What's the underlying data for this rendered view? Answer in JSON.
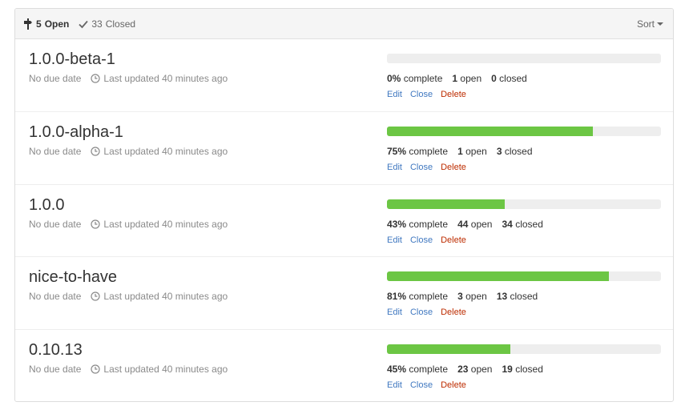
{
  "header": {
    "open_count": "5",
    "open_label": "Open",
    "closed_count": "33",
    "closed_label": "Closed",
    "sort_label": "Sort"
  },
  "colors": {
    "progress_fill": "#6cc644",
    "progress_track": "#eeeeee",
    "link": "#4078c0",
    "delete": "#bd2c00"
  },
  "actions": {
    "edit": "Edit",
    "close": "Close",
    "delete": "Delete"
  },
  "milestones": [
    {
      "title": "1.0.0-beta-1",
      "due": "No due date",
      "updated": "Last updated 40 minutes ago",
      "percent": 0,
      "percent_label": "0%",
      "complete_label": "complete",
      "open": "1",
      "open_label": "open",
      "closed": "0",
      "closed_label": "closed"
    },
    {
      "title": "1.0.0-alpha-1",
      "due": "No due date",
      "updated": "Last updated 40 minutes ago",
      "percent": 75,
      "percent_label": "75%",
      "complete_label": "complete",
      "open": "1",
      "open_label": "open",
      "closed": "3",
      "closed_label": "closed"
    },
    {
      "title": "1.0.0",
      "due": "No due date",
      "updated": "Last updated 40 minutes ago",
      "percent": 43,
      "percent_label": "43%",
      "complete_label": "complete",
      "open": "44",
      "open_label": "open",
      "closed": "34",
      "closed_label": "closed"
    },
    {
      "title": "nice-to-have",
      "due": "No due date",
      "updated": "Last updated 40 minutes ago",
      "percent": 81,
      "percent_label": "81%",
      "complete_label": "complete",
      "open": "3",
      "open_label": "open",
      "closed": "13",
      "closed_label": "closed"
    },
    {
      "title": "0.10.13",
      "due": "No due date",
      "updated": "Last updated 40 minutes ago",
      "percent": 45,
      "percent_label": "45%",
      "complete_label": "complete",
      "open": "23",
      "open_label": "open",
      "closed": "19",
      "closed_label": "closed"
    }
  ]
}
